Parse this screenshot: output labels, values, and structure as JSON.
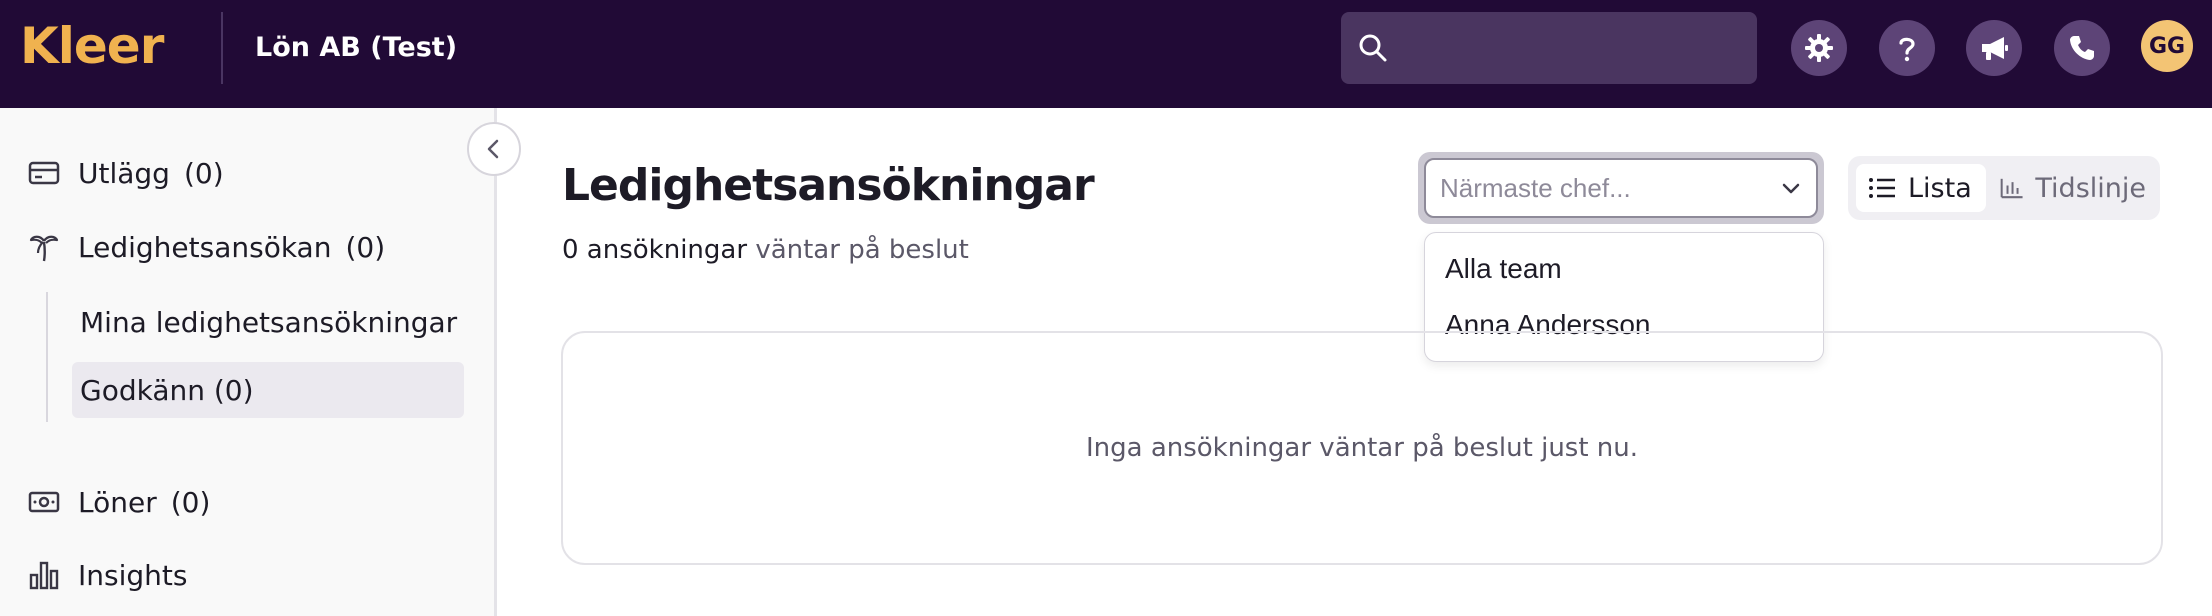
{
  "header": {
    "logo_text": "Kleer",
    "company_name": "Lön AB (Test)",
    "search_placeholder": "",
    "icons": [
      "search-icon",
      "gear-icon",
      "help-icon",
      "megaphone-icon",
      "phone-icon"
    ],
    "avatar_initials": "GG",
    "colors": {
      "background": "#210a36",
      "logo": "#f0b24f",
      "button": "#5d4477",
      "avatar": "#f3c474"
    }
  },
  "sidebar": {
    "items": [
      {
        "label": "Utlägg",
        "count": "(0)",
        "icon": "receipt-card-icon"
      },
      {
        "label": "Ledighetsansökan",
        "count": "(0)",
        "icon": "palm-tree-icon"
      },
      {
        "label": "Löner",
        "count": "(0)",
        "icon": "banknote-icon"
      },
      {
        "label": "Insights",
        "count": "",
        "icon": "bar-chart-icon"
      }
    ],
    "subitems": [
      {
        "label": "Mina ledighetsansökningar",
        "active": false
      },
      {
        "label": "Godkänn (0)",
        "active": true
      }
    ]
  },
  "main": {
    "title": "Ledighetsansökningar",
    "subtitle_count": "0 ansökningar",
    "subtitle_text": "väntar på beslut",
    "manager_select": {
      "placeholder": "Närmaste chef...",
      "value": "",
      "options": [
        "Alla team",
        "Anna Andersson"
      ]
    },
    "view_toggle": [
      {
        "label": "Lista",
        "icon": "list-icon",
        "active": true
      },
      {
        "label": "Tidslinje",
        "icon": "timeline-chart-icon",
        "active": false
      }
    ],
    "empty_message": "Inga ansökningar väntar på beslut just nu."
  }
}
